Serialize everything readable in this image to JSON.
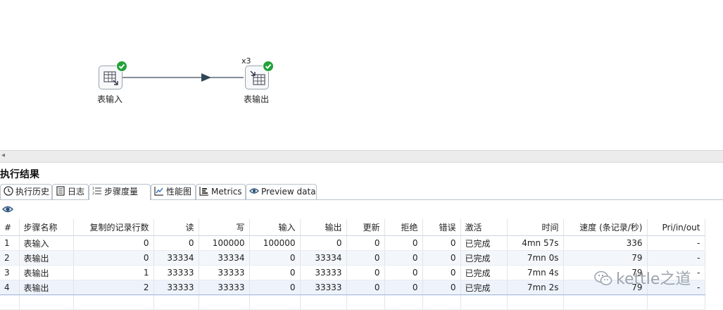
{
  "canvas": {
    "steps": [
      {
        "name": "表输入",
        "status": "success"
      },
      {
        "name": "表输出",
        "status": "success",
        "copies_label": "x3"
      }
    ]
  },
  "results": {
    "title": "执行结果",
    "tabs": [
      {
        "label": "执行历史",
        "icon": "clock-icon"
      },
      {
        "label": "日志",
        "icon": "log-icon"
      },
      {
        "label": "步骤度量",
        "icon": "list-numbered-icon",
        "active": true
      },
      {
        "label": "性能图",
        "icon": "chart-icon"
      },
      {
        "label": "Metrics",
        "icon": "metrics-icon"
      },
      {
        "label": "Preview data",
        "icon": "eye-icon"
      }
    ],
    "toolbar": {
      "icon": "eye-icon"
    },
    "columns": [
      "#",
      "步骤名称",
      "复制的记录行数",
      "读",
      "写",
      "输入",
      "输出",
      "更新",
      "拒绝",
      "错误",
      "激活",
      "时间",
      "速度 (条记录/秒)",
      "Pri/in/out"
    ],
    "rows": [
      [
        "1",
        "表输入",
        "0",
        "0",
        "100000",
        "100000",
        "0",
        "0",
        "0",
        "0",
        "已完成",
        "4mn 57s",
        "336",
        "-"
      ],
      [
        "2",
        "表输出",
        "0",
        "33334",
        "33334",
        "0",
        "33334",
        "0",
        "0",
        "0",
        "已完成",
        "7mn 0s",
        "79",
        "-"
      ],
      [
        "3",
        "表输出",
        "1",
        "33333",
        "33333",
        "0",
        "33333",
        "0",
        "0",
        "0",
        "已完成",
        "7mn 4s",
        "79",
        "-"
      ],
      [
        "4",
        "表输出",
        "2",
        "33333",
        "33333",
        "0",
        "33333",
        "0",
        "0",
        "0",
        "已完成",
        "7mn 2s",
        "79",
        "-"
      ]
    ]
  },
  "watermark": {
    "text": "kettle之道"
  }
}
